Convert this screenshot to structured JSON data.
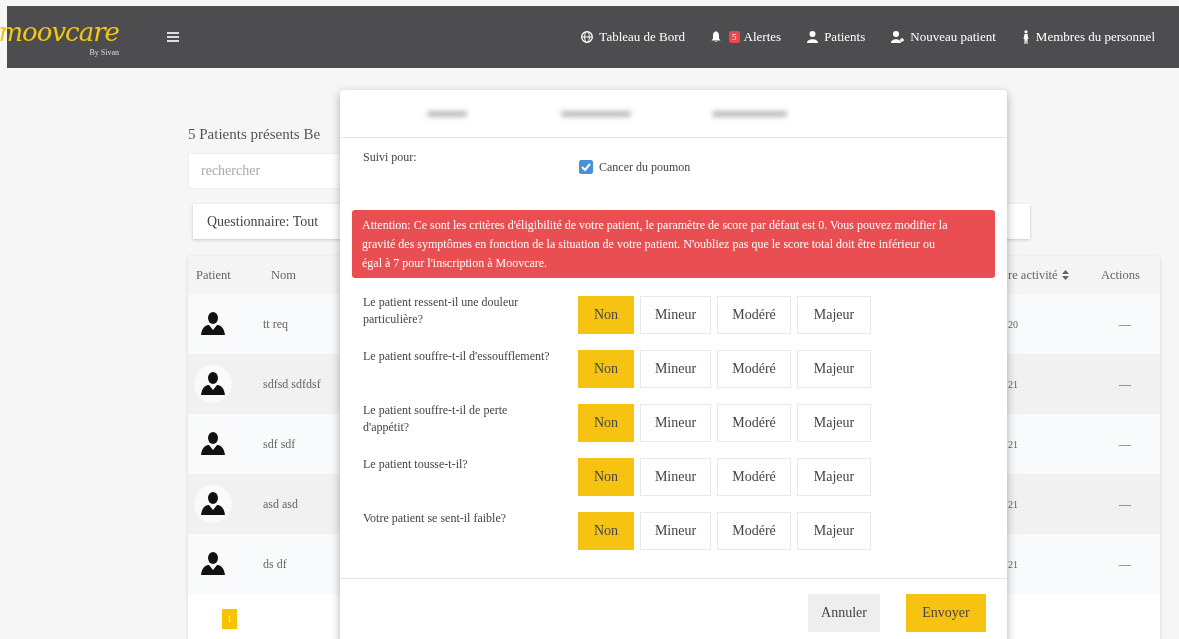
{
  "navbar": {
    "logo": "moovcare",
    "logo_sub": "By Sivan",
    "items": [
      {
        "kind": "globe",
        "label": "Tableau de Bord"
      },
      {
        "kind": "bell",
        "label": "Alertes",
        "badge": "5"
      },
      {
        "kind": "user",
        "label": "Patients"
      },
      {
        "kind": "user-plus",
        "label": "Nouveau patient"
      },
      {
        "kind": "staff",
        "label": "Membres du personnel"
      }
    ]
  },
  "page": {
    "title": "5 Patients présents Be",
    "search": {
      "placeholder": "rechercher"
    },
    "filter": "Questionnaire: Tout",
    "table": {
      "columns": [
        "Patient",
        "Nom",
        "re activité",
        "Actions"
      ],
      "rows": [
        {
          "name": "tt req",
          "date": "20",
          "actions": "—"
        },
        {
          "name": "sdfsd sdfdsf",
          "date": "21",
          "actions": "—"
        },
        {
          "name": "sdf sdf",
          "date": "21",
          "actions": "—"
        },
        {
          "name": "asd asd",
          "date": "21",
          "actions": "—"
        },
        {
          "name": "ds df",
          "date": "21",
          "actions": "—"
        }
      ]
    },
    "pagination": [
      {
        "label": "1",
        "selected": true
      }
    ]
  },
  "modal": {
    "follow_label": "Suivi pour:",
    "conditions": [
      {
        "label": "Cancer du poumon",
        "checked": true
      }
    ],
    "alert": "Attention: Ce sont les critères d'éligibilité de votre patient, le paramètre de score par défaut est 0. Vous pouvez modifier la gravité des symptômes en fonction de la situation de votre patient. N'oubliez pas que le score total doit être inférieur ou égal à 7 pour l'inscription à Moovcare.",
    "questions": [
      {
        "text": "Le patient ressent-il une douleur particulière?",
        "options": [
          {
            "label": "Non",
            "selected": true
          },
          {
            "label": "Mineur",
            "selected": false
          },
          {
            "label": "Modéré",
            "selected": false
          },
          {
            "label": "Majeur",
            "selected": false
          }
        ]
      },
      {
        "text": "Le patient souffre-t-il d'essoufflement?",
        "options": [
          {
            "label": "Non",
            "selected": true
          },
          {
            "label": "Mineur",
            "selected": false
          },
          {
            "label": "Modéré",
            "selected": false
          },
          {
            "label": "Majeur",
            "selected": false
          }
        ]
      },
      {
        "text": "Le patient souffre-t-il de perte d'appétit?",
        "options": [
          {
            "label": "Non",
            "selected": true
          },
          {
            "label": "Mineur",
            "selected": false
          },
          {
            "label": "Modéré",
            "selected": false
          },
          {
            "label": "Majeur",
            "selected": false
          }
        ]
      },
      {
        "text": "Le patient tousse-t-il?",
        "options": [
          {
            "label": "Non",
            "selected": true
          },
          {
            "label": "Mineur",
            "selected": false
          },
          {
            "label": "Modéré",
            "selected": false
          },
          {
            "label": "Majeur",
            "selected": false
          }
        ]
      },
      {
        "text": "Votre patient se sent-il faible?",
        "options": [
          {
            "label": "Non",
            "selected": true
          },
          {
            "label": "Mineur",
            "selected": false
          },
          {
            "label": "Modéré",
            "selected": false
          },
          {
            "label": "Majeur",
            "selected": false
          }
        ]
      }
    ],
    "buttons": [
      {
        "label": "Annuler",
        "kind": "secondary"
      },
      {
        "label": "Envoyer",
        "kind": "primary"
      }
    ]
  }
}
